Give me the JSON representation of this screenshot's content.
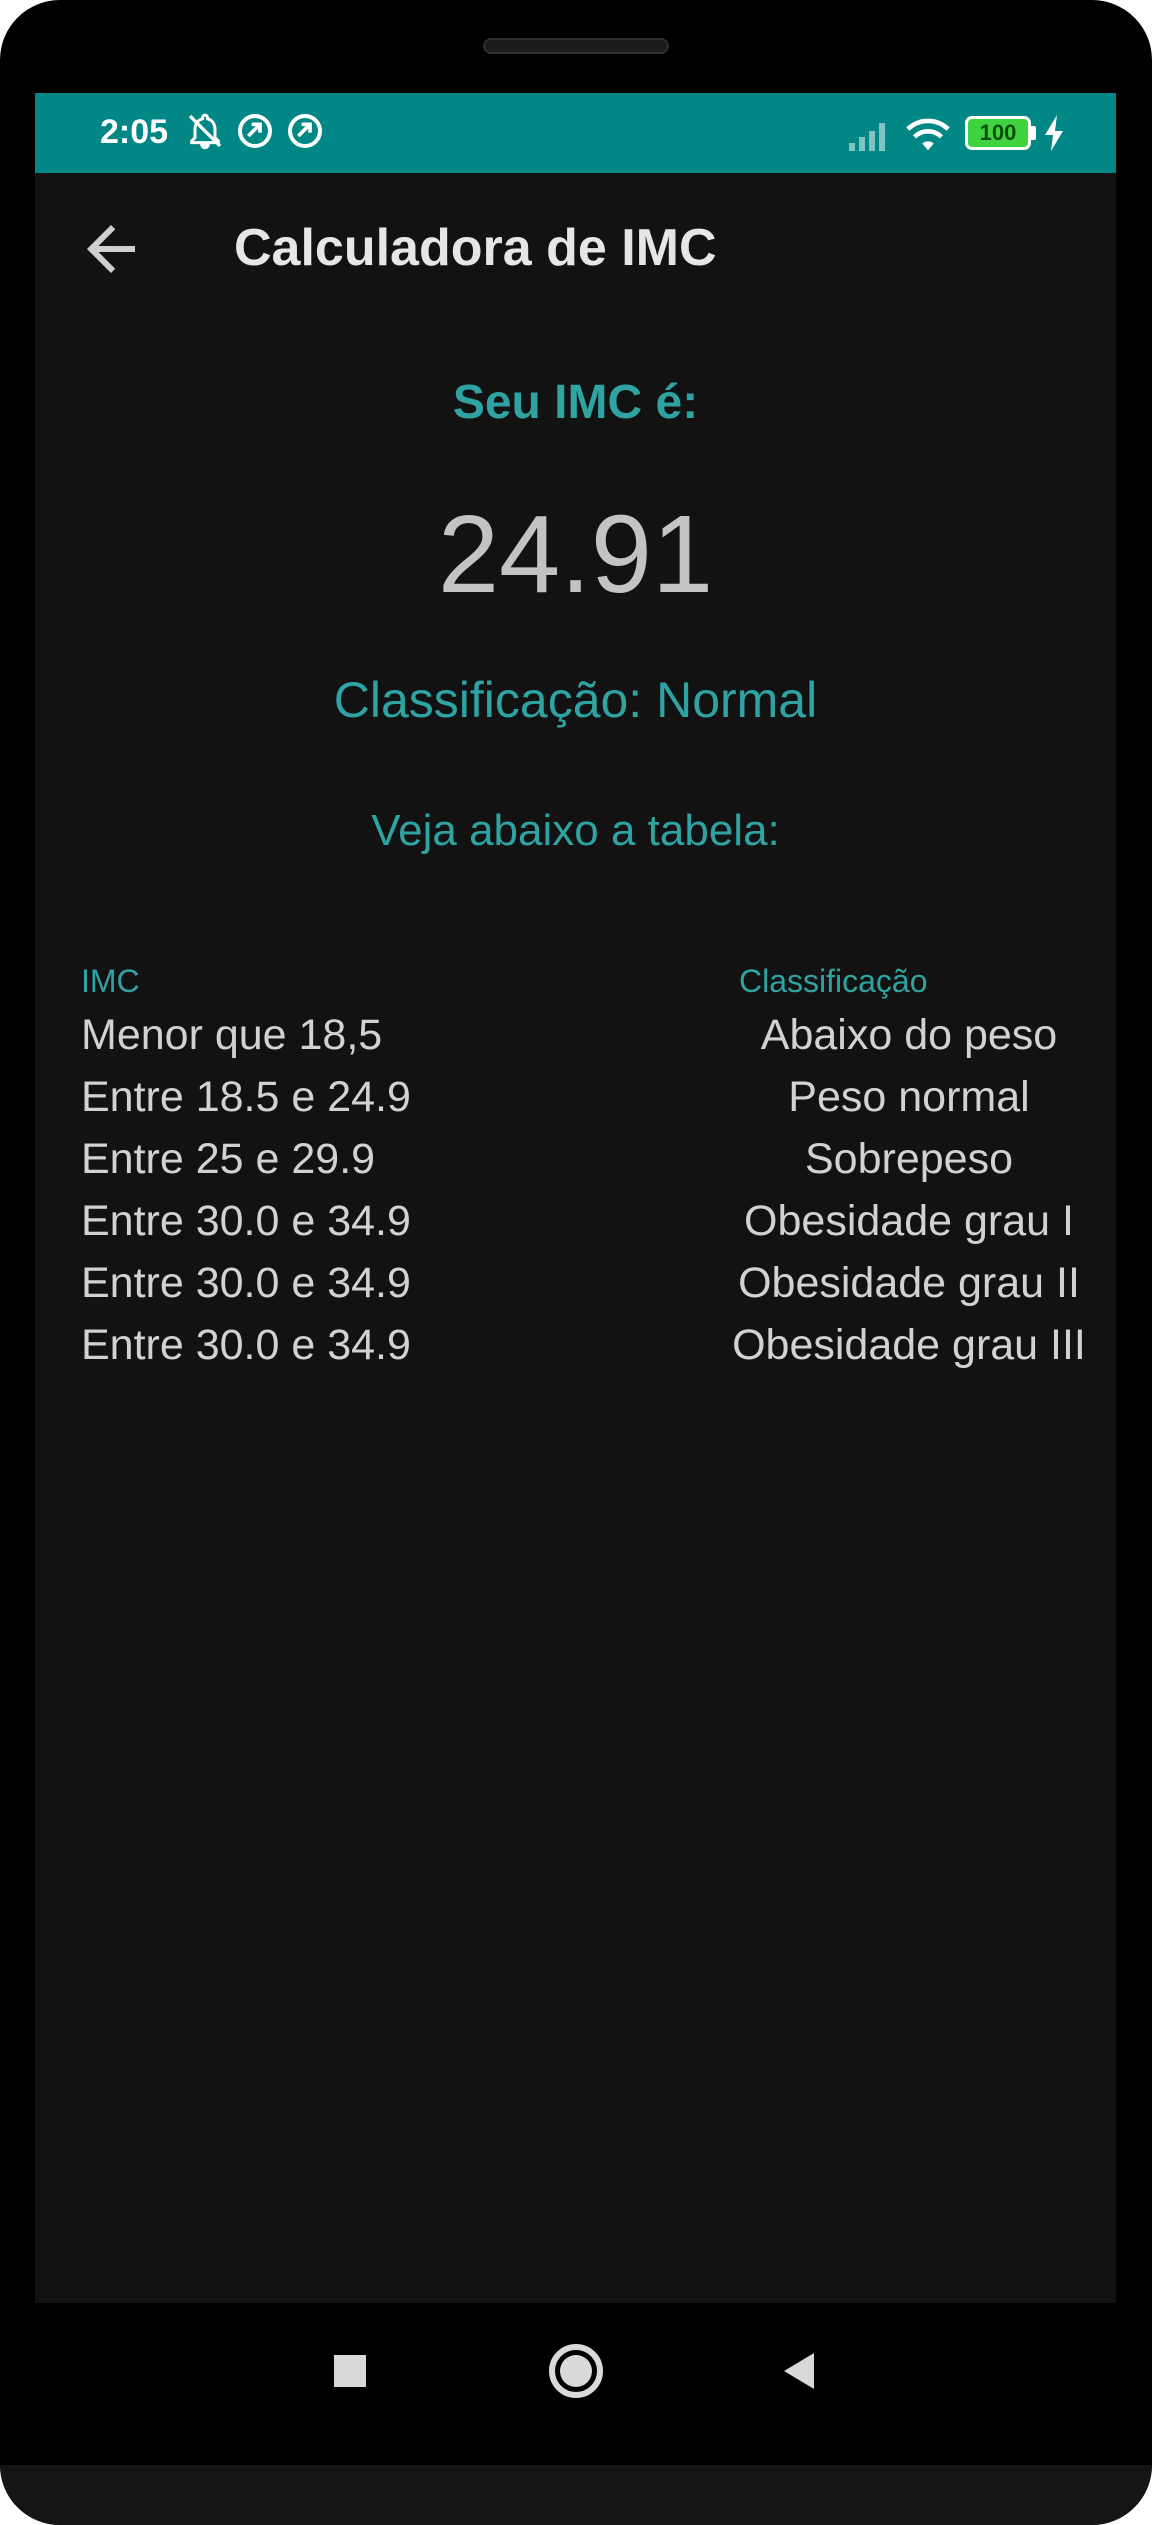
{
  "status_bar": {
    "time": "2:05",
    "battery": "100",
    "background_color": "#018786",
    "icons": [
      "notifications-off-icon",
      "sync-icon",
      "sync-icon",
      "signal-icon",
      "wifi-icon",
      "battery-icon",
      "charging-icon"
    ]
  },
  "app_bar": {
    "title": "Calculadora de IMC",
    "back_icon": "arrow-back-icon"
  },
  "result": {
    "label": "Seu IMC é:",
    "value": "24.91",
    "classification": "Classificação: Normal",
    "table_caption": "Veja abaixo a tabela:"
  },
  "table": {
    "headers": [
      "IMC",
      "Classificação"
    ],
    "rows": [
      {
        "imc": "Menor que 18,5",
        "classification": "Abaixo do peso"
      },
      {
        "imc": "Entre 18.5 e 24.9",
        "classification": "Peso normal"
      },
      {
        "imc": "Entre 25 e 29.9",
        "classification": "Sobrepeso"
      },
      {
        "imc": "Entre 30.0 e 34.9",
        "classification": "Obesidade grau I"
      },
      {
        "imc": "Entre 30.0 e 34.9",
        "classification": "Obesidade grau II"
      },
      {
        "imc": "Entre 30.0 e 34.9",
        "classification": "Obesidade grau III"
      }
    ]
  },
  "nav_bar": {
    "buttons": [
      "recents-icon",
      "home-icon",
      "back-icon"
    ]
  },
  "colors": {
    "accent": "#2fa3a2",
    "background": "#121212",
    "text": "#d2d2d2"
  }
}
